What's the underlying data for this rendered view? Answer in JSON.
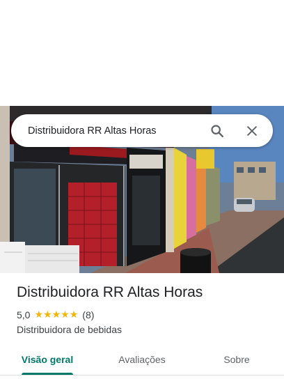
{
  "search": {
    "query": "Distribuidora RR Altas Horas"
  },
  "icons": {
    "search": "search-icon",
    "close": "close-icon",
    "star": "star-icon"
  },
  "place": {
    "name": "Distribuidora RR Altas Horas",
    "rating": "5,0",
    "stars": 5,
    "reviews": "(8)",
    "category": "Distribuidora de bebidas"
  },
  "tabs": [
    {
      "label": "Visão geral",
      "active": true
    },
    {
      "label": "Avaliações",
      "active": false
    },
    {
      "label": "Sobre",
      "active": false
    }
  ],
  "colors": {
    "accent": "#00796b",
    "star": "#f4b400",
    "text": "#202124",
    "secondary": "#3c4043"
  }
}
